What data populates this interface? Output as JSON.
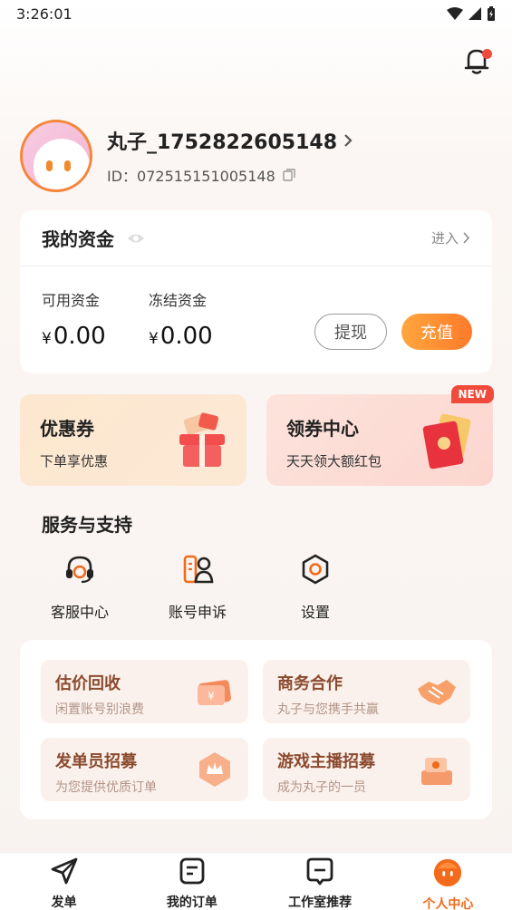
{
  "status_bar": {
    "time": "3:26:01"
  },
  "profile": {
    "username": "丸子_1752822605148",
    "id_label": "ID：",
    "id_value": "072515151005148"
  },
  "funds": {
    "title": "我的资金",
    "enter_label": "进入",
    "available_label": "可用资金",
    "available_value": "0.00",
    "frozen_label": "冻结资金",
    "frozen_value": "0.00",
    "currency_symbol": "¥",
    "withdraw_label": "提现",
    "recharge_label": "充值"
  },
  "promos": [
    {
      "title": "优惠券",
      "subtitle": "下单享优惠"
    },
    {
      "title": "领券中心",
      "subtitle": "天天领大额红包",
      "badge": "NEW"
    }
  ],
  "services": {
    "title": "服务与支持",
    "items": [
      {
        "label": "客服中心",
        "icon": "headset-icon"
      },
      {
        "label": "账号申诉",
        "icon": "account-appeal-icon"
      },
      {
        "label": "设置",
        "icon": "gear-icon"
      }
    ]
  },
  "tiles": [
    {
      "title": "估价回收",
      "subtitle": "闲置账号别浪费"
    },
    {
      "title": "商务合作",
      "subtitle": "丸子与您携手共赢"
    },
    {
      "title": "发单员招募",
      "subtitle": "为您提供优质订单"
    },
    {
      "title": "游戏主播招募",
      "subtitle": "成为丸子的一员"
    }
  ],
  "tabs": [
    {
      "label": "发单",
      "icon": "send-icon"
    },
    {
      "label": "我的订单",
      "icon": "orders-icon"
    },
    {
      "label": "工作室推荐",
      "icon": "studio-icon"
    },
    {
      "label": "个人中心",
      "icon": "profile-mascot-icon",
      "active": true
    }
  ],
  "colors": {
    "accent": "#ff7a2a",
    "badge": "#f04a3a",
    "tab_active": "#f06a1a"
  }
}
